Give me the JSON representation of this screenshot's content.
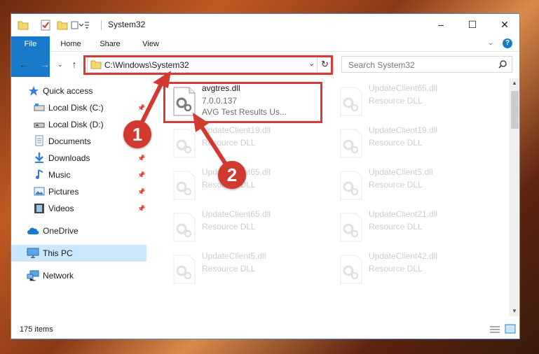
{
  "window": {
    "title": "System32",
    "controls": {
      "minimize": "–",
      "maximize": "☐",
      "close": "✕"
    }
  },
  "ribbon": {
    "tabs": [
      "File",
      "Home",
      "Share",
      "View"
    ]
  },
  "address": {
    "path": "C:\\Windows\\System32"
  },
  "search": {
    "placeholder": "Search System32"
  },
  "sidebar": {
    "items": [
      {
        "label": "Quick access",
        "icon": "star-icon",
        "pinned": false
      },
      {
        "label": "Local Disk (C:)",
        "icon": "drive-icon",
        "pinned": true
      },
      {
        "label": "Local Disk (D:)",
        "icon": "drive-icon",
        "pinned": true
      },
      {
        "label": "Documents",
        "icon": "documents-icon",
        "pinned": true
      },
      {
        "label": "Downloads",
        "icon": "download-icon",
        "pinned": true
      },
      {
        "label": "Music",
        "icon": "music-icon",
        "pinned": true
      },
      {
        "label": "Pictures",
        "icon": "pictures-icon",
        "pinned": true
      },
      {
        "label": "Videos",
        "icon": "videos-icon",
        "pinned": true
      },
      {
        "label": "OneDrive",
        "icon": "cloud-icon",
        "pinned": false
      },
      {
        "label": "This PC",
        "icon": "computer-icon",
        "pinned": false,
        "selected": true
      },
      {
        "label": "Network",
        "icon": "network-icon",
        "pinned": false
      }
    ]
  },
  "files": [
    {
      "name": "avgtres.dll",
      "line2": "7.0.0.137",
      "line3": "AVG Test Results Us...",
      "highlighted": true
    },
    {
      "name": "UpdateClient65.dll",
      "line2": "Resource DLL"
    },
    {
      "name": "UpdateClient19.dll",
      "line2": "Resource DLL"
    },
    {
      "name": "UpdateClient19.dll",
      "line2": "Resource DLL"
    },
    {
      "name": "UpdateClient65.dll",
      "line2": "Resource DLL"
    },
    {
      "name": "UpdateClient5.dll",
      "line2": "Resource DLL"
    },
    {
      "name": "UpdateClient65.dll",
      "line2": "Resource DLL"
    },
    {
      "name": "UpdateClient21.dll",
      "line2": "Resource DLL"
    },
    {
      "name": "UpdateClient5.dll",
      "line2": "Resource DLL"
    },
    {
      "name": "UpdateClient42.dll",
      "line2": "Resource DLL"
    }
  ],
  "status": {
    "count": "175 items"
  },
  "callouts": [
    "1",
    "2"
  ],
  "colors": {
    "accent": "#1979ca",
    "highlight": "#d63b3b",
    "callout": "#d23a2f",
    "selected": "#cce8ff"
  }
}
